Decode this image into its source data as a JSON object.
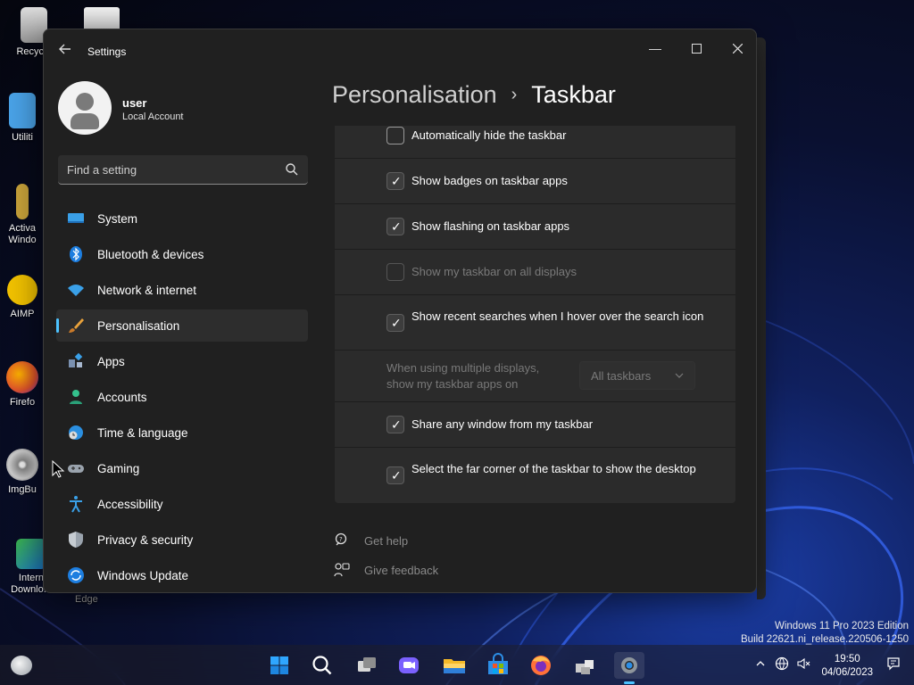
{
  "desktop": {
    "icons": [
      {
        "label": "Recycle",
        "icon": "recycle-bin-icon"
      },
      {
        "label": "Utiliti",
        "icon": "folder-icon"
      },
      {
        "label": "Activa Windo",
        "icon": "key-icon"
      },
      {
        "label": "AIMP",
        "icon": "aimp-icon"
      },
      {
        "label": "Firefo",
        "icon": "firefox-icon"
      },
      {
        "label": "ImgBu",
        "icon": "imgburn-icon"
      },
      {
        "label": "Intern Downlo...",
        "icon": "idm-icon"
      },
      {
        "label": "Edge",
        "icon": "edge-icon"
      }
    ]
  },
  "window": {
    "title": "Settings",
    "back_icon": "back-arrow-icon",
    "controls": {
      "minimize": "minimize-icon",
      "maximize": "maximize-icon",
      "close": "close-icon"
    }
  },
  "profile": {
    "name": "user",
    "account_type": "Local Account"
  },
  "search": {
    "placeholder": "Find a setting"
  },
  "nav": {
    "items": [
      {
        "label": "System",
        "icon": "system-icon"
      },
      {
        "label": "Bluetooth & devices",
        "icon": "bluetooth-icon"
      },
      {
        "label": "Network & internet",
        "icon": "wifi-icon"
      },
      {
        "label": "Personalisation",
        "icon": "brush-icon",
        "active": true
      },
      {
        "label": "Apps",
        "icon": "apps-icon"
      },
      {
        "label": "Accounts",
        "icon": "accounts-icon"
      },
      {
        "label": "Time & language",
        "icon": "globe-clock-icon"
      },
      {
        "label": "Gaming",
        "icon": "gamepad-icon"
      },
      {
        "label": "Accessibility",
        "icon": "accessibility-icon"
      },
      {
        "label": "Privacy & security",
        "icon": "shield-icon"
      },
      {
        "label": "Windows Update",
        "icon": "update-icon"
      }
    ]
  },
  "breadcrumb": {
    "parent": "Personalisation",
    "separator": "›",
    "current": "Taskbar"
  },
  "taskbar_behaviors": {
    "options": [
      {
        "label": "Automatically hide the taskbar",
        "checked": false,
        "enabled": true
      },
      {
        "label": "Show badges on taskbar apps",
        "checked": true,
        "enabled": true
      },
      {
        "label": "Show flashing on taskbar apps",
        "checked": true,
        "enabled": true
      },
      {
        "label": "Show my taskbar on all displays",
        "checked": false,
        "enabled": false
      },
      {
        "label": "Show recent searches when I hover over the search icon",
        "checked": true,
        "enabled": true
      },
      {
        "label": "Share any window from my taskbar",
        "checked": true,
        "enabled": true
      },
      {
        "label": "Select the far corner of the taskbar to show the desktop",
        "checked": true,
        "enabled": true
      }
    ],
    "multi_display": {
      "label": "When using multiple displays, show my taskbar apps on",
      "value": "All taskbars",
      "enabled": false
    }
  },
  "help": {
    "get_help": "Get help",
    "give_feedback": "Give feedback"
  },
  "watermark": {
    "line1": "Windows 11 Pro 2023 Edition",
    "line2": "Build 22621.ni_release.220506-1250"
  },
  "taskbar": {
    "apps": [
      "start-icon",
      "search-icon",
      "task-view-icon",
      "chat-icon",
      "file-explorer-icon",
      "store-icon",
      "firefox-icon",
      "package-icon",
      "settings-icon"
    ],
    "clock": {
      "time": "19:50",
      "date": "04/06/2023"
    }
  },
  "colors": {
    "accent": "#4cc2ff",
    "window_bg": "#202020",
    "card_bg": "#2b2b2b"
  }
}
